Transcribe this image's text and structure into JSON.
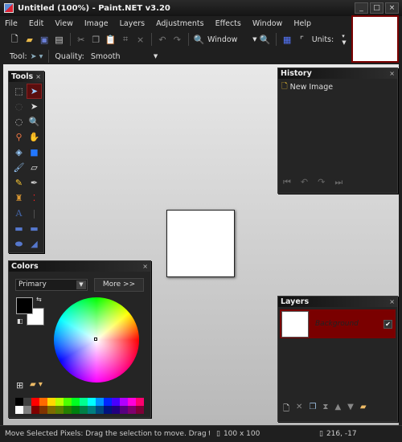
{
  "window": {
    "title": "Untitled (100%) - Paint.NET v3.20",
    "minimize": "_",
    "maximize": "□",
    "close": "×"
  },
  "menu": [
    "File",
    "Edit",
    "View",
    "Image",
    "Layers",
    "Adjustments",
    "Effects",
    "Window",
    "Help"
  ],
  "toolbar": {
    "icons": [
      "new-icon",
      "open-icon",
      "save-icon",
      "print-icon",
      "cut-icon",
      "copy-icon",
      "paste-icon",
      "crop-icon",
      "deselect-icon",
      "undo-icon",
      "redo-icon"
    ],
    "zoom_value": "Window",
    "units_label": "Units:"
  },
  "toolbar2": {
    "tool_label": "Tool:",
    "quality_label": "Quality:",
    "quality_value": "Smooth"
  },
  "tools": {
    "title": "Tools",
    "close": "×"
  },
  "history": {
    "title": "History",
    "close": "×",
    "items": [
      "New Image"
    ]
  },
  "colors": {
    "title": "Colors",
    "close": "×",
    "mode": "Primary",
    "more_button": "More >>",
    "primary_color": "#000000",
    "secondary_color": "#ffffff",
    "palette_top": [
      "#000000",
      "#404040",
      "#ff0000",
      "#ff6a00",
      "#ffd800",
      "#b6ff00",
      "#4cff00",
      "#00ff21",
      "#00ff90",
      "#00ffff",
      "#0094ff",
      "#0026ff",
      "#4800ff",
      "#b200ff",
      "#ff00dc",
      "#ff006e"
    ],
    "palette_bottom": [
      "#ffffff",
      "#808080",
      "#7f0000",
      "#7f3300",
      "#7f6a00",
      "#5b7f00",
      "#267f00",
      "#007f0e",
      "#007f46",
      "#007f7f",
      "#004a7f",
      "#00137f",
      "#21007f",
      "#57007f",
      "#7f006e",
      "#7f0037"
    ]
  },
  "layers": {
    "title": "Layers",
    "close": "×",
    "items": [
      {
        "name": "Background",
        "visible": true
      }
    ]
  },
  "status": {
    "message": "Move Selected Pixels: Drag the selection to move. Drag the nub",
    "size": "100 x 100",
    "cursor": "216, -17"
  }
}
